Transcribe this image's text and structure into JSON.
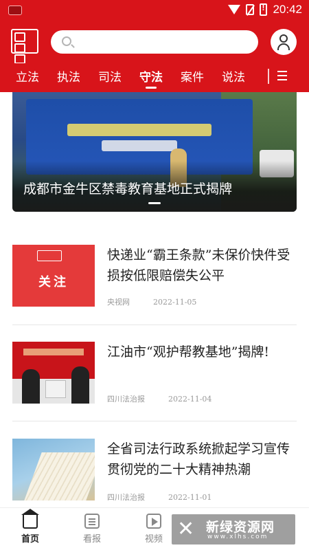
{
  "status_bar": {
    "time": "20:42",
    "icons": [
      "app-notification-icon",
      "wifi-icon",
      "no-sim-icon",
      "battery-alert-icon"
    ]
  },
  "header": {
    "logo_icon": "app-logo-icon",
    "search": {
      "placeholder": "",
      "value": ""
    },
    "user_icon": "user-icon"
  },
  "tabs": [
    {
      "label": "立法"
    },
    {
      "label": "执法"
    },
    {
      "label": "司法"
    },
    {
      "label": "守法",
      "active": true
    },
    {
      "label": "案件"
    },
    {
      "label": "说法"
    }
  ],
  "banner": {
    "caption": "成都市金牛区禁毒教育基地正式揭牌",
    "current_slide": 1
  },
  "news": [
    {
      "title": "快递业“霸王条款”未保价快件受损按低限赔偿失公平",
      "source": "央视网",
      "date": "2022-11-05",
      "thumb_label": "关注"
    },
    {
      "title": "江油市“观护帮教基地”揭牌!",
      "source": "四川法治报",
      "date": "2022-11-04"
    },
    {
      "title": "全省司法行政系统掀起学习宣传贯彻党的二十大精神热潮",
      "source": "四川法治报",
      "date": "2022-11-01"
    }
  ],
  "bottom_nav": [
    {
      "label": "首页",
      "icon": "home-icon",
      "active": true
    },
    {
      "label": "看报",
      "icon": "newspaper-icon"
    },
    {
      "label": "视频",
      "icon": "video-icon"
    }
  ],
  "watermark": {
    "name": "新绿资源网",
    "url": "www.xlhs.com"
  },
  "colors": {
    "brand_red": "#d8141a",
    "text_dark": "#222222",
    "text_meta": "#999999"
  }
}
